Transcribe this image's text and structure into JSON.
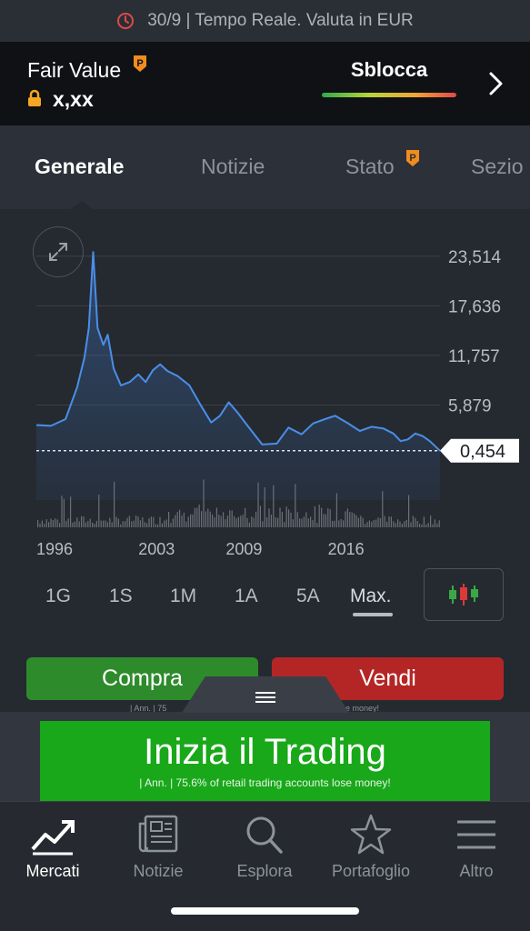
{
  "status": {
    "text": "30/9 | Tempo Reale. Valuta in EUR",
    "icon": "clock-icon"
  },
  "fair_value": {
    "title": "Fair Value",
    "value": "x,xx",
    "unlock_label": "Sblocca",
    "badge_icon": "premium-p-icon",
    "lock_icon": "lock-icon"
  },
  "tabs": [
    {
      "label": "Generale",
      "active": true
    },
    {
      "label": "Notizie"
    },
    {
      "label": "Stato",
      "badge": "premium-p-icon"
    },
    {
      "label": "Sezio"
    }
  ],
  "chart_data": {
    "type": "area",
    "x_ticks": [
      "1996",
      "2003",
      "2009",
      "2016"
    ],
    "y_ticks": [
      "23,514",
      "17,636",
      "11,757",
      "5,879"
    ],
    "ylim": [
      0,
      25
    ],
    "x_range": [
      1996,
      2023.7
    ],
    "current_value": "0,454",
    "series": [
      {
        "x": [
          1996.0,
          1997.0,
          1998.0,
          1998.8,
          1999.3,
          1999.6,
          1999.9,
          2000.2,
          2000.6,
          2000.9,
          2001.3,
          2001.8,
          2002.4,
          2003.0,
          2003.5,
          2004.0,
          2004.5,
          2005.0,
          2005.7,
          2006.5,
          2007.3,
          2008.0,
          2008.6,
          2009.2,
          2009.8,
          2010.5,
          2011.5,
          2012.5,
          2013.3,
          2014.2,
          2015.0,
          2015.8,
          2016.5,
          2017.3,
          2018.2,
          2019.0,
          2019.8,
          2020.5,
          2021.0,
          2021.5,
          2022.0,
          2022.5,
          2023.0,
          2023.7
        ],
        "y": [
          3.5,
          3.4,
          4.2,
          8.0,
          11.5,
          15.0,
          24.0,
          15.0,
          13.0,
          14.2,
          10.2,
          8.2,
          8.6,
          9.5,
          8.6,
          10.0,
          10.7,
          9.9,
          9.3,
          8.2,
          5.8,
          3.8,
          4.6,
          6.2,
          5.0,
          3.4,
          1.2,
          1.3,
          3.2,
          2.4,
          3.7,
          4.2,
          4.6,
          3.8,
          2.8,
          3.3,
          3.1,
          2.5,
          1.6,
          1.8,
          2.5,
          2.2,
          1.6,
          0.454
        ]
      }
    ]
  },
  "ranges": [
    {
      "label": "1G"
    },
    {
      "label": "1S"
    },
    {
      "label": "1M"
    },
    {
      "label": "1A"
    },
    {
      "label": "5A"
    },
    {
      "label": "Max.",
      "active": true
    }
  ],
  "trade": {
    "buy": "Compra",
    "sell": "Vendi",
    "note_left": "| Ann. | 75",
    "note_right": "e money!"
  },
  "ad": {
    "title": "Inizia il Trading",
    "subtitle": "| Ann. | 75.6% of retail trading accounts lose money!"
  },
  "nav": [
    {
      "label": "Mercati",
      "icon": "chart-trend-icon",
      "active": true
    },
    {
      "label": "Notizie",
      "icon": "newspaper-icon"
    },
    {
      "label": "Esplora",
      "icon": "search-icon"
    },
    {
      "label": "Portafoglio",
      "icon": "star-icon"
    },
    {
      "label": "Altro",
      "icon": "menu-icon"
    }
  ],
  "colors": {
    "line": "#4a8ee8",
    "buy": "#2e8b2c",
    "sell": "#b42626",
    "ad": "#19a81a"
  }
}
